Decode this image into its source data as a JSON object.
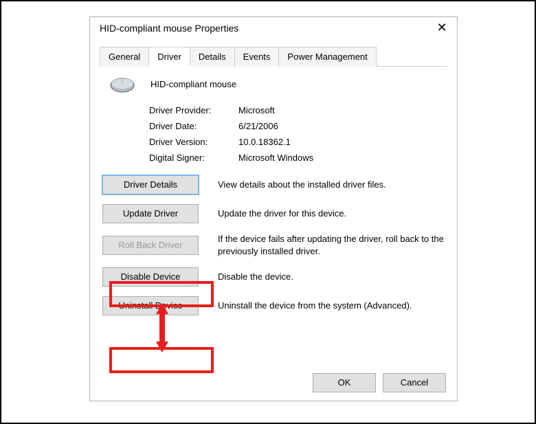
{
  "window": {
    "title": "HID-compliant mouse Properties"
  },
  "tabs": {
    "general": "General",
    "driver": "Driver",
    "details": "Details",
    "events": "Events",
    "power": "Power Management"
  },
  "device": {
    "name": "HID-compliant mouse"
  },
  "info": {
    "provider_label": "Driver Provider:",
    "provider_value": "Microsoft",
    "date_label": "Driver Date:",
    "date_value": "6/21/2006",
    "version_label": "Driver Version:",
    "version_value": "10.0.18362.1",
    "signer_label": "Digital Signer:",
    "signer_value": "Microsoft Windows"
  },
  "actions": {
    "details_btn": "Driver Details",
    "details_desc": "View details about the installed driver files.",
    "update_btn": "Update Driver",
    "update_desc": "Update the driver for this device.",
    "rollback_btn": "Roll Back Driver",
    "rollback_desc": "If the device fails after updating the driver, roll back to the previously installed driver.",
    "disable_btn": "Disable Device",
    "disable_desc": "Disable the device.",
    "uninstall_btn": "Uninstall Device",
    "uninstall_desc": "Uninstall the device from the system (Advanced)."
  },
  "footer": {
    "ok": "OK",
    "cancel": "Cancel"
  }
}
